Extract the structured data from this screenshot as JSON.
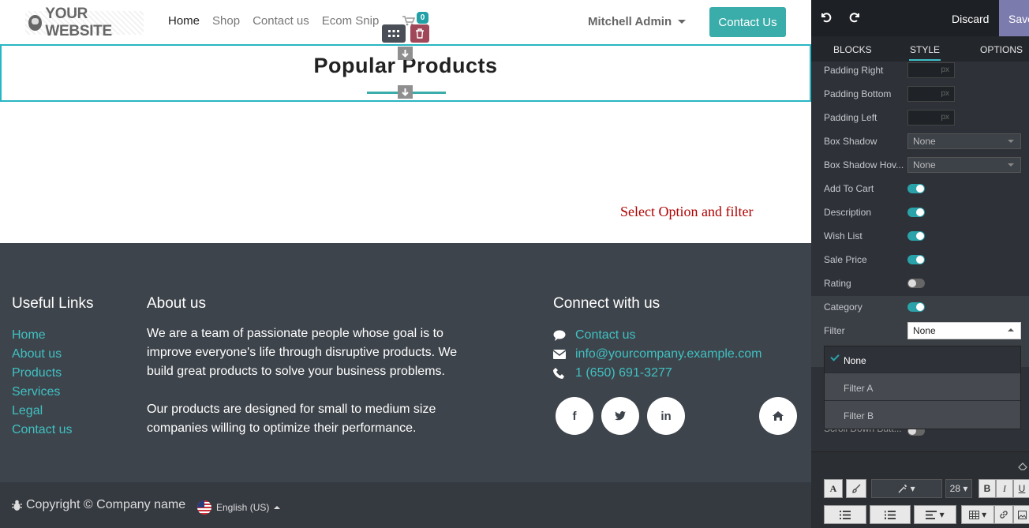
{
  "site": {
    "logo_text": "YOUR WEBSITE",
    "nav": [
      "Home",
      "Shop",
      "Contact us",
      "Ecom Snip"
    ],
    "cart_count": "0",
    "user_name": "Mitchell Admin",
    "cta_label": "Contact Us"
  },
  "section": {
    "title": "Popular Products",
    "message": "Select Option and filter"
  },
  "footer": {
    "useful_links_heading": "Useful Links",
    "useful_links": [
      "Home",
      "About us",
      "Products",
      "Services",
      "Legal",
      "Contact us"
    ],
    "about_heading": "About us",
    "about_p1": "We are a team of passionate people whose goal is to improve everyone's life through disruptive products. We build great products to solve your business problems.",
    "about_p2": "Our products are designed for small to medium size companies willing to optimize their performance.",
    "connect_heading": "Connect with us",
    "contact_label": "Contact us",
    "email": "info@yourcompany.example.com",
    "phone": "1 (650) 691-3277",
    "copyright": "Copyright © Company name",
    "language": "English (US)"
  },
  "editor": {
    "discard": "Discard",
    "save": "Save",
    "tabs": [
      "BLOCKS",
      "STYLE",
      "OPTIONS"
    ],
    "active_tab": "STYLE",
    "px_unit": "px",
    "options": {
      "padding_right": "Padding Right",
      "padding_bottom": "Padding Bottom",
      "padding_left": "Padding Left",
      "box_shadow": "Box Shadow",
      "box_shadow_value": "None",
      "box_shadow_hover": "Box Shadow Hov...",
      "box_shadow_hover_value": "None",
      "add_to_cart": "Add To Cart",
      "description": "Description",
      "wish_list": "Wish List",
      "sale_price": "Sale Price",
      "rating": "Rating",
      "category": "Category",
      "filter": "Filter",
      "filter_value": "None",
      "scroll_down": "Scroll Down Butt..."
    },
    "toggles": {
      "add_to_cart": true,
      "description": true,
      "wish_list": true,
      "sale_price": true,
      "rating": false,
      "category": true,
      "scroll_down": false
    },
    "filter_options": [
      "None",
      "Filter A",
      "Filter B"
    ],
    "filter_selected": "None",
    "font_size": "28"
  },
  "colors": {
    "accent": "#3aadaa",
    "footer_bg": "#3e444b",
    "editor_bg": "#2e3238",
    "selection_border": "#28b6c4",
    "link": "#3fc1c3",
    "warning_text": "#b00000"
  }
}
